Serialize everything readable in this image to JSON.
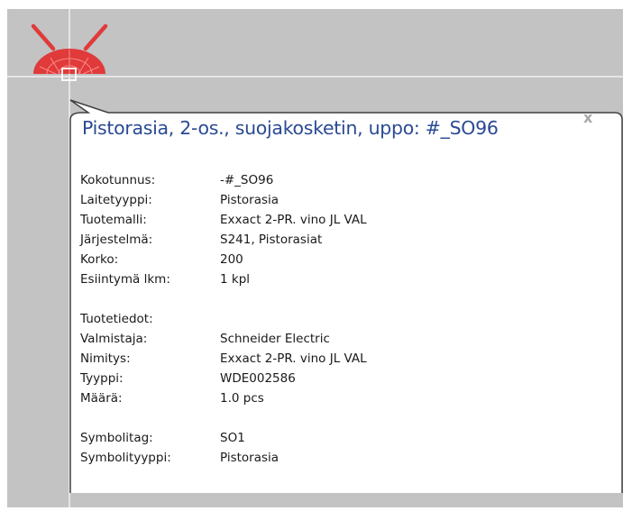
{
  "tooltip": {
    "title": "Pistorasia, 2-os., suojakosketin, uppo: #_SO96",
    "close_glyph": "x",
    "general": [
      {
        "label": "Kokotunnus:",
        "value": "-#_SO96"
      },
      {
        "label": "Laitetyyppi:",
        "value": "Pistorasia"
      },
      {
        "label": "Tuotemalli:",
        "value": "Exxact 2-PR. vino JL VAL"
      },
      {
        "label": "Järjestelmä:",
        "value": "S241, Pistorasiat"
      },
      {
        "label": "Korko:",
        "value": "200"
      },
      {
        "label": "Esiintymä lkm:",
        "value": "1 kpl"
      }
    ],
    "product_heading": "Tuotetiedot:",
    "product": [
      {
        "label": "Valmistaja:",
        "value": "Schneider Electric"
      },
      {
        "label": "Nimitys:",
        "value": "Exxact 2-PR. vino JL VAL"
      },
      {
        "label": "Tyyppi:",
        "value": "WDE002586"
      },
      {
        "label": "Määrä:",
        "value": "1.0 pcs"
      }
    ],
    "symbol_info": [
      {
        "label": "Symbolitag:",
        "value": "SO1"
      },
      {
        "label": "Symbolityyppi:",
        "value": "Pistorasia"
      }
    ]
  },
  "icons": {
    "symbol": "socket-symbol-icon",
    "close": "close-icon"
  },
  "colors": {
    "canvas": "#c3c3c3",
    "symbol_red": "#e03a3a",
    "title_blue": "#2a4a94"
  }
}
